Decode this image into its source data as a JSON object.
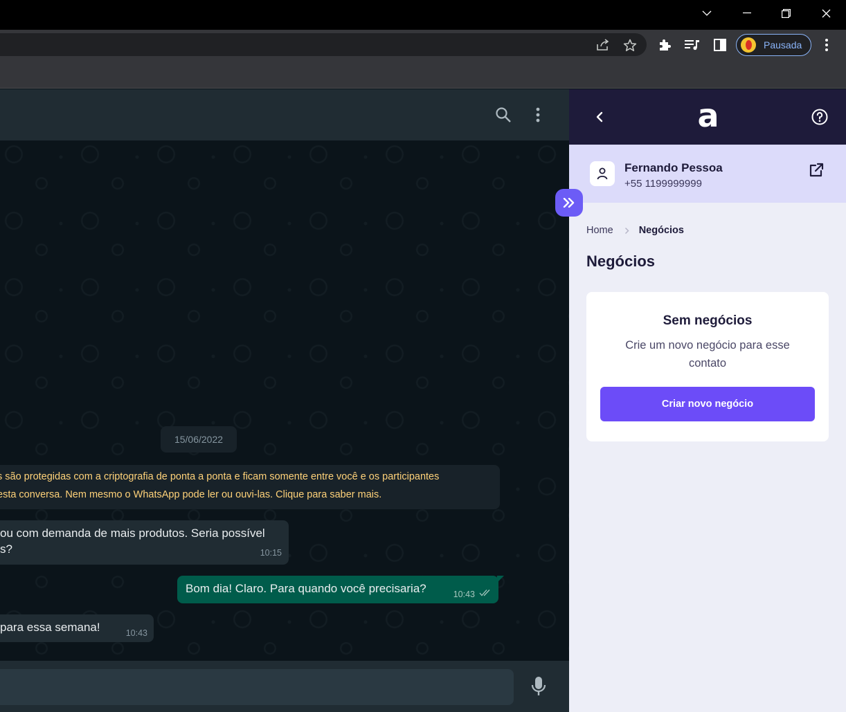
{
  "browser": {
    "profile": {
      "label": "Pausada"
    },
    "icons": {
      "window": [
        "chevron-down-icon",
        "minimize-icon",
        "restore-icon",
        "close-icon"
      ],
      "toolbar": [
        "share-icon",
        "star-icon",
        "extensions-icon",
        "media-queue-icon",
        "side-panel-icon",
        "menu-icon"
      ]
    }
  },
  "chat": {
    "date": "15/06/2022",
    "encryption_notice": {
      "line1": "s são protegidas com a criptografia de ponta a ponta e ficam somente entre você e os participantes",
      "line2": "esta conversa. Nem mesmo o WhatsApp pode ler ou ouvi-las. Clique para saber mais."
    },
    "messages": [
      {
        "direction": "in",
        "line1": "ou com demanda de mais produtos. Seria possível",
        "line2": "s?",
        "time": "10:15"
      },
      {
        "direction": "out",
        "text": "Bom dia! Claro. Para quando você precisaria?",
        "time": "10:43"
      },
      {
        "direction": "in",
        "text": "para essa semana!",
        "time": "10:43"
      }
    ],
    "input": {
      "value": "",
      "placeholder": ""
    }
  },
  "panel": {
    "logo": "a",
    "contact": {
      "name": "Fernando Pessoa",
      "phone": "+55 1199999999"
    },
    "breadcrumb": {
      "home": "Home",
      "current": "Negócios"
    },
    "title": "Negócios",
    "empty_state": {
      "title": "Sem negócios",
      "description": "Crie um novo negócio para esse contato",
      "button": "Criar novo negócio"
    },
    "colors": {
      "header": "#1e1b3a",
      "accent": "#6c4cf8",
      "contact_bg": "#dcdbfa",
      "panel_bg": "#edeef7"
    }
  }
}
